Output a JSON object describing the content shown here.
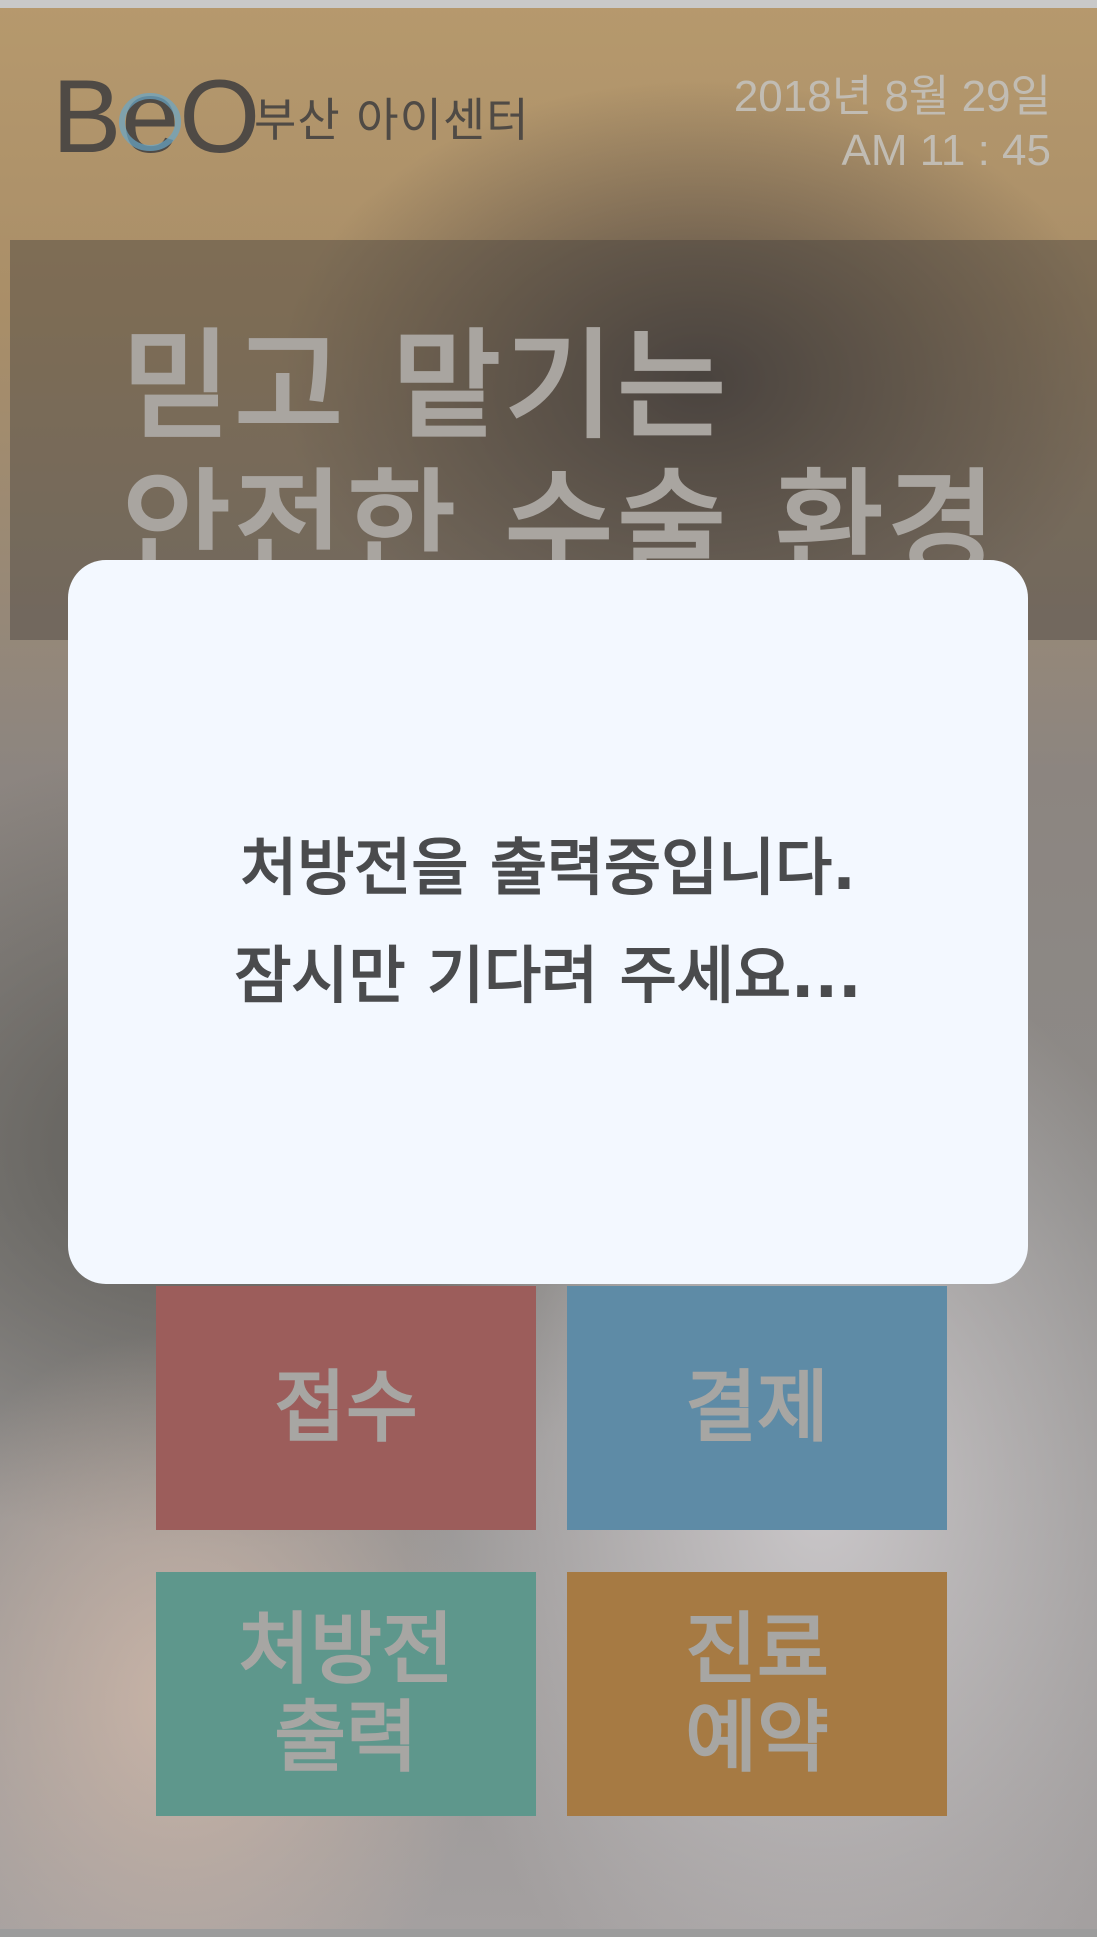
{
  "header": {
    "logo_mark": "BeO",
    "logo_text": "부산 아이센터",
    "date": "2018년 8월 29일",
    "time": "AM 11 : 45"
  },
  "banner": {
    "line1": "믿고 맡기는",
    "line2": "안전한 수술 환경"
  },
  "menu": {
    "reception": "접수",
    "payment": "결제",
    "prescription_line1": "처방전",
    "prescription_line2": "출력",
    "booking_line1": "진료",
    "booking_line2": "예약"
  },
  "dialog": {
    "line1": "처방전을 출력중입니다.",
    "line2": "잠시만 기다려 주세요..."
  },
  "colors": {
    "reception": "#9c5d5b",
    "payment": "#5e8ba6",
    "prescription": "#5e978c",
    "booking": "#a67a43",
    "dialog_bg": "#f3f8ff"
  }
}
